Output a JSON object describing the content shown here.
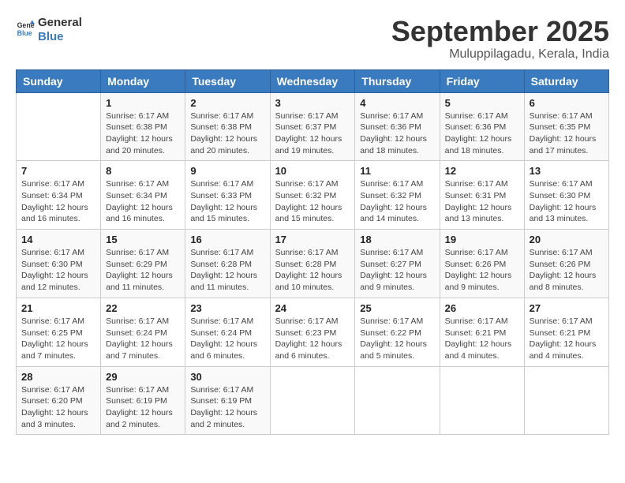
{
  "logo": {
    "general": "General",
    "blue": "Blue"
  },
  "title": {
    "month": "September 2025",
    "location": "Muluppilagadu, Kerala, India"
  },
  "headers": [
    "Sunday",
    "Monday",
    "Tuesday",
    "Wednesday",
    "Thursday",
    "Friday",
    "Saturday"
  ],
  "weeks": [
    [
      {
        "day": "",
        "info": ""
      },
      {
        "day": "1",
        "info": "Sunrise: 6:17 AM\nSunset: 6:38 PM\nDaylight: 12 hours\nand 20 minutes."
      },
      {
        "day": "2",
        "info": "Sunrise: 6:17 AM\nSunset: 6:38 PM\nDaylight: 12 hours\nand 20 minutes."
      },
      {
        "day": "3",
        "info": "Sunrise: 6:17 AM\nSunset: 6:37 PM\nDaylight: 12 hours\nand 19 minutes."
      },
      {
        "day": "4",
        "info": "Sunrise: 6:17 AM\nSunset: 6:36 PM\nDaylight: 12 hours\nand 18 minutes."
      },
      {
        "day": "5",
        "info": "Sunrise: 6:17 AM\nSunset: 6:36 PM\nDaylight: 12 hours\nand 18 minutes."
      },
      {
        "day": "6",
        "info": "Sunrise: 6:17 AM\nSunset: 6:35 PM\nDaylight: 12 hours\nand 17 minutes."
      }
    ],
    [
      {
        "day": "7",
        "info": "Sunrise: 6:17 AM\nSunset: 6:34 PM\nDaylight: 12 hours\nand 16 minutes."
      },
      {
        "day": "8",
        "info": "Sunrise: 6:17 AM\nSunset: 6:34 PM\nDaylight: 12 hours\nand 16 minutes."
      },
      {
        "day": "9",
        "info": "Sunrise: 6:17 AM\nSunset: 6:33 PM\nDaylight: 12 hours\nand 15 minutes."
      },
      {
        "day": "10",
        "info": "Sunrise: 6:17 AM\nSunset: 6:32 PM\nDaylight: 12 hours\nand 15 minutes."
      },
      {
        "day": "11",
        "info": "Sunrise: 6:17 AM\nSunset: 6:32 PM\nDaylight: 12 hours\nand 14 minutes."
      },
      {
        "day": "12",
        "info": "Sunrise: 6:17 AM\nSunset: 6:31 PM\nDaylight: 12 hours\nand 13 minutes."
      },
      {
        "day": "13",
        "info": "Sunrise: 6:17 AM\nSunset: 6:30 PM\nDaylight: 12 hours\nand 13 minutes."
      }
    ],
    [
      {
        "day": "14",
        "info": "Sunrise: 6:17 AM\nSunset: 6:30 PM\nDaylight: 12 hours\nand 12 minutes."
      },
      {
        "day": "15",
        "info": "Sunrise: 6:17 AM\nSunset: 6:29 PM\nDaylight: 12 hours\nand 11 minutes."
      },
      {
        "day": "16",
        "info": "Sunrise: 6:17 AM\nSunset: 6:28 PM\nDaylight: 12 hours\nand 11 minutes."
      },
      {
        "day": "17",
        "info": "Sunrise: 6:17 AM\nSunset: 6:28 PM\nDaylight: 12 hours\nand 10 minutes."
      },
      {
        "day": "18",
        "info": "Sunrise: 6:17 AM\nSunset: 6:27 PM\nDaylight: 12 hours\nand 9 minutes."
      },
      {
        "day": "19",
        "info": "Sunrise: 6:17 AM\nSunset: 6:26 PM\nDaylight: 12 hours\nand 9 minutes."
      },
      {
        "day": "20",
        "info": "Sunrise: 6:17 AM\nSunset: 6:26 PM\nDaylight: 12 hours\nand 8 minutes."
      }
    ],
    [
      {
        "day": "21",
        "info": "Sunrise: 6:17 AM\nSunset: 6:25 PM\nDaylight: 12 hours\nand 7 minutes."
      },
      {
        "day": "22",
        "info": "Sunrise: 6:17 AM\nSunset: 6:24 PM\nDaylight: 12 hours\nand 7 minutes."
      },
      {
        "day": "23",
        "info": "Sunrise: 6:17 AM\nSunset: 6:24 PM\nDaylight: 12 hours\nand 6 minutes."
      },
      {
        "day": "24",
        "info": "Sunrise: 6:17 AM\nSunset: 6:23 PM\nDaylight: 12 hours\nand 6 minutes."
      },
      {
        "day": "25",
        "info": "Sunrise: 6:17 AM\nSunset: 6:22 PM\nDaylight: 12 hours\nand 5 minutes."
      },
      {
        "day": "26",
        "info": "Sunrise: 6:17 AM\nSunset: 6:21 PM\nDaylight: 12 hours\nand 4 minutes."
      },
      {
        "day": "27",
        "info": "Sunrise: 6:17 AM\nSunset: 6:21 PM\nDaylight: 12 hours\nand 4 minutes."
      }
    ],
    [
      {
        "day": "28",
        "info": "Sunrise: 6:17 AM\nSunset: 6:20 PM\nDaylight: 12 hours\nand 3 minutes."
      },
      {
        "day": "29",
        "info": "Sunrise: 6:17 AM\nSunset: 6:19 PM\nDaylight: 12 hours\nand 2 minutes."
      },
      {
        "day": "30",
        "info": "Sunrise: 6:17 AM\nSunset: 6:19 PM\nDaylight: 12 hours\nand 2 minutes."
      },
      {
        "day": "",
        "info": ""
      },
      {
        "day": "",
        "info": ""
      },
      {
        "day": "",
        "info": ""
      },
      {
        "day": "",
        "info": ""
      }
    ]
  ]
}
